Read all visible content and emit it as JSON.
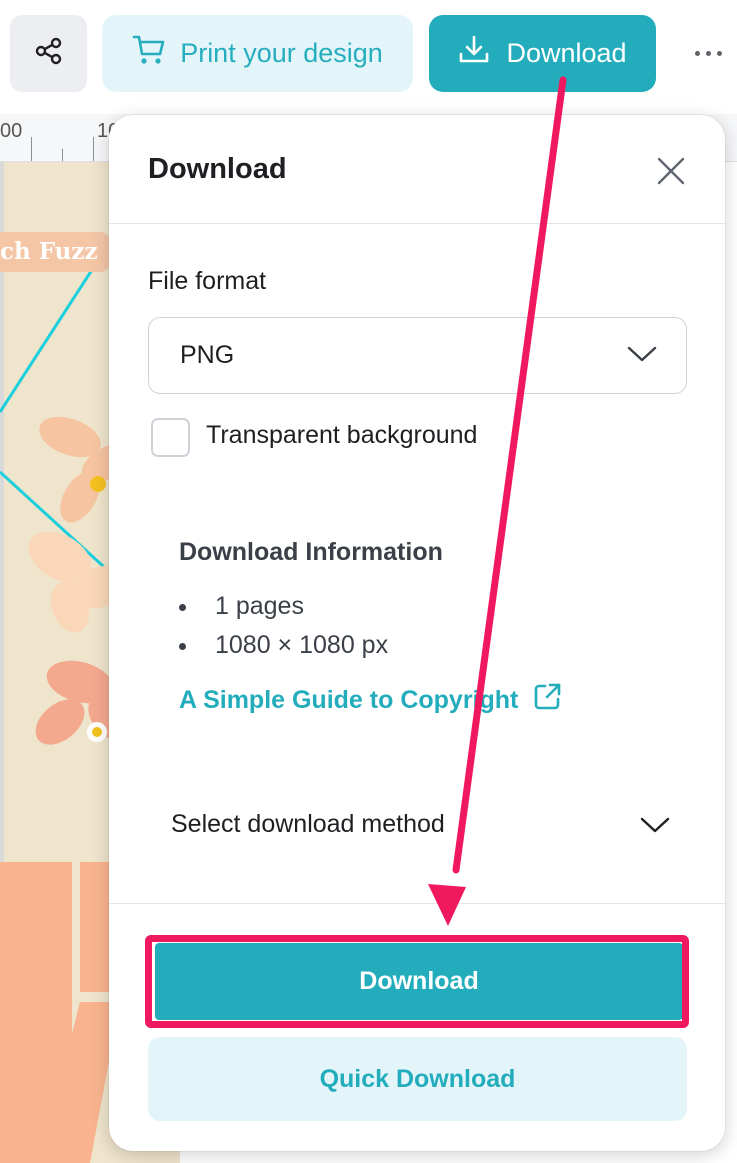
{
  "toolbar": {
    "print_label": "Print your design",
    "download_label": "Download"
  },
  "ruler": {
    "labels": [
      "00",
      "10"
    ]
  },
  "canvas": {
    "tag_text": "ch Fuzz"
  },
  "download_panel": {
    "title": "Download",
    "file_format_label": "File format",
    "file_format_value": "PNG",
    "transparent_background_label": "Transparent background",
    "transparent_background_checked": false,
    "info_title": "Download Information",
    "info_items": [
      "1 pages",
      "1080 × 1080 px"
    ],
    "guide_link_label": "A Simple Guide to Copyright",
    "method_label": "Select download method",
    "download_button_label": "Download",
    "quick_download_label": "Quick Download"
  },
  "colors": {
    "accent": "#23adbc",
    "accent_light": "#e4f5fa",
    "annotation": "#f0185e",
    "canvas_bg": "#efe4cc",
    "canvas_peach": "#f9b48f"
  },
  "icons": {
    "share": "share-icon",
    "cart": "cart-icon",
    "download": "download-icon",
    "more": "more-icon",
    "close": "close-icon",
    "chevron": "chevron-down-icon",
    "external": "external-link-icon"
  }
}
